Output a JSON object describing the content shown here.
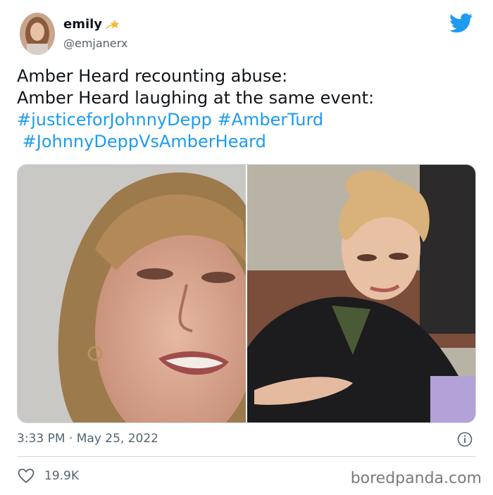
{
  "tweet": {
    "author_name": "emily",
    "author_handle": "@emjanerx",
    "text_lines": [
      "Amber Heard recounting abuse:",
      "Amber Heard laughing at the same event:"
    ],
    "hashtags_line1": [
      "#justiceforJohnnyDepp",
      "#AmberTurd"
    ],
    "hashtags_line2": [
      "#JohnnyDeppVsAmberHeard"
    ],
    "timestamp": "3:33 PM · May 25, 2022",
    "like_count": "19.9K"
  },
  "watermark": "boredpanda.com",
  "icons": {
    "brand": "twitter-bird-icon",
    "verified_decoration": "star-emoji-icon",
    "info": "info-icon",
    "like": "heart-icon"
  },
  "colors": {
    "brand_blue": "#1d9bf0",
    "text_primary": "#0f1419",
    "text_secondary": "#536471",
    "border": "#cfd9de"
  }
}
